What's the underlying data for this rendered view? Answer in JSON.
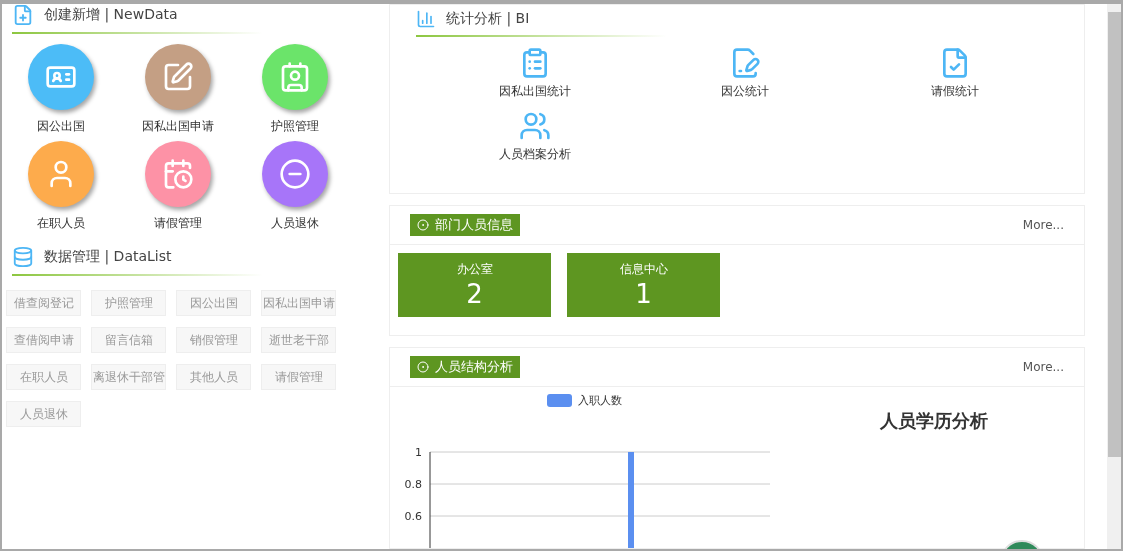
{
  "create_section": {
    "title": "创建新增 | NewData",
    "items": [
      {
        "label": "因公出国",
        "color": "#4cbcf7"
      },
      {
        "label": "因私出国申请",
        "color": "#c49f84"
      },
      {
        "label": "护照管理",
        "color": "#6be46a"
      },
      {
        "label": "在职人员",
        "color": "#fdab4c"
      },
      {
        "label": "请假管理",
        "color": "#fd92a6"
      },
      {
        "label": "人员退休",
        "color": "#a775f9"
      }
    ]
  },
  "data_section": {
    "title": "数据管理 | DataList",
    "tags": [
      "借查阅登记",
      "护照管理",
      "因公出国",
      "因私出国申请",
      "查借阅申请",
      "留言信箱",
      "销假管理",
      "逝世老干部",
      "在职人员",
      "离退休干部管",
      "其他人员",
      "请假管理",
      "人员退休"
    ]
  },
  "bi_section": {
    "title": "统计分析 | BI",
    "items": [
      {
        "label": "因私出国统计"
      },
      {
        "label": "因公统计"
      },
      {
        "label": "请假统计"
      },
      {
        "label": "人员档案分析"
      }
    ]
  },
  "dept_panel": {
    "title": "部门人员信息",
    "more": "More...",
    "tiles": [
      {
        "name": "办公室",
        "count": "2"
      },
      {
        "name": "信息中心",
        "count": "1"
      }
    ]
  },
  "structure_panel": {
    "title": "人员结构分析",
    "more": "More...",
    "pie_title": "人员学历分析",
    "chart_data": {
      "type": "bar",
      "series": [
        {
          "name": "入职人数",
          "color": "#5b8ff0",
          "values": [
            1
          ]
        }
      ],
      "ylim": [
        0.4,
        1
      ],
      "yticks": [
        0.6,
        0.8,
        1
      ]
    }
  }
}
